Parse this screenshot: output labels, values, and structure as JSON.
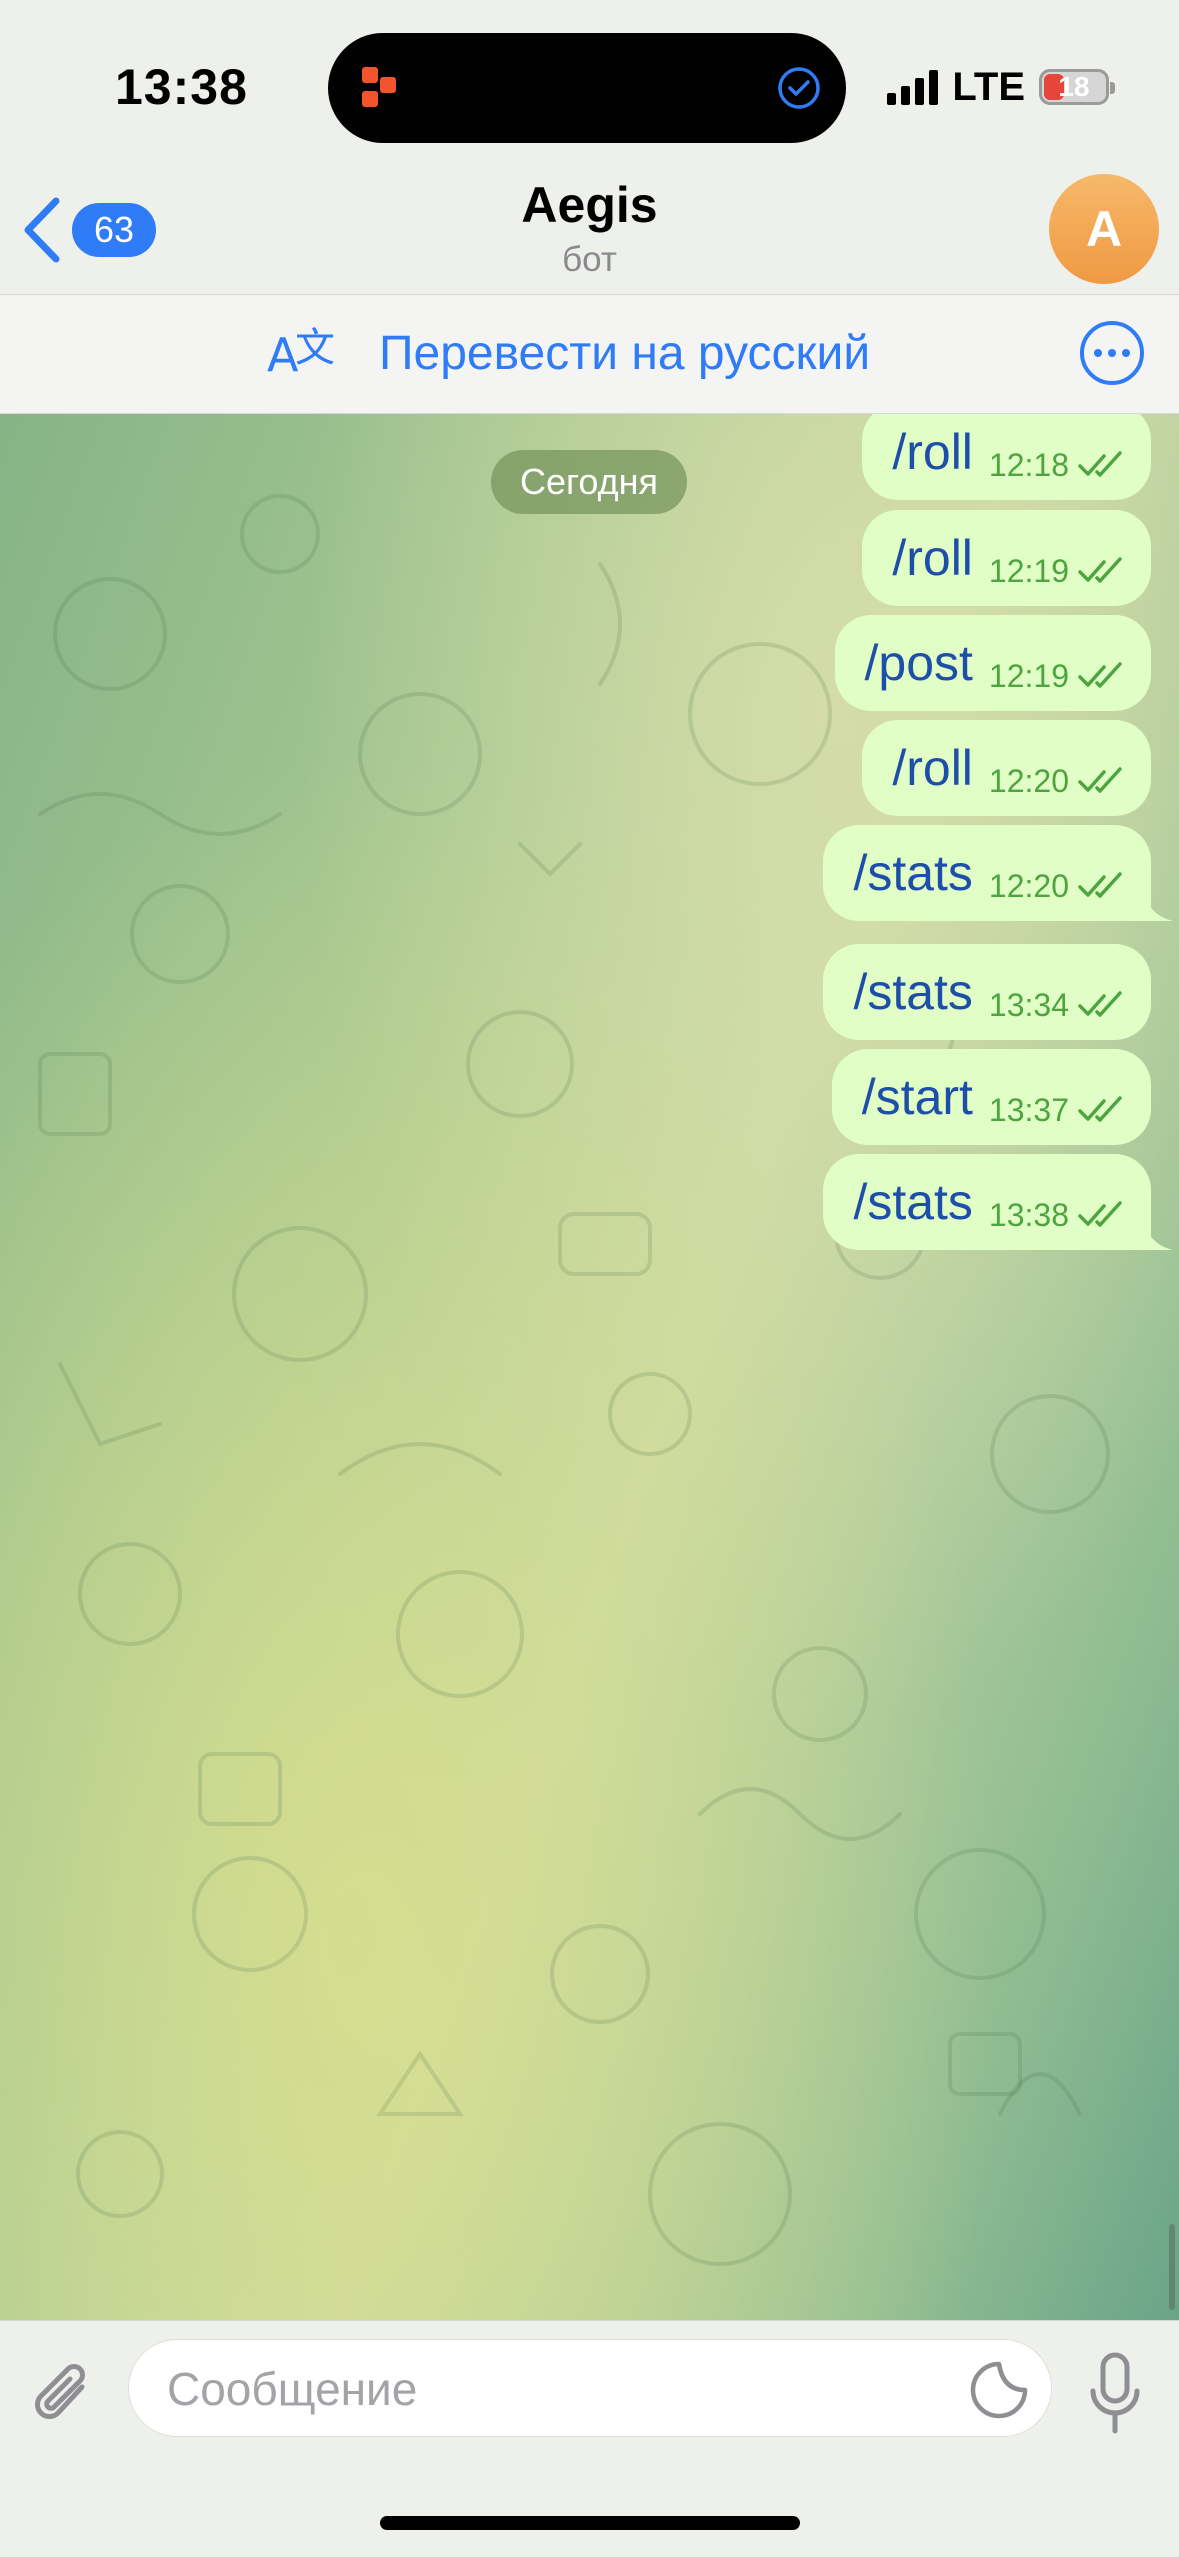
{
  "status_bar": {
    "time": "13:38",
    "network": "LTE",
    "battery": "18",
    "battery_color": "#e5453b"
  },
  "header": {
    "back_count": "63",
    "title": "Aegis",
    "subtitle": "бот",
    "avatar_letter": "A",
    "accent": "#2f7cf6"
  },
  "translate_bar": {
    "label": "Перевести на русский",
    "icon": "translate-icon"
  },
  "chat": {
    "date_label": "Сегодня",
    "messages": [
      {
        "text": "/roll",
        "time": "12:18"
      },
      {
        "text": "/roll",
        "time": "12:19"
      },
      {
        "text": "/post",
        "time": "12:19"
      },
      {
        "text": "/roll",
        "time": "12:20"
      },
      {
        "text": "/stats",
        "time": "12:20"
      },
      {
        "text": "/stats",
        "time": "13:34"
      },
      {
        "text": "/start",
        "time": "13:37"
      },
      {
        "text": "/stats",
        "time": "13:38"
      }
    ]
  },
  "input": {
    "placeholder": "Сообщение",
    "value": ""
  }
}
